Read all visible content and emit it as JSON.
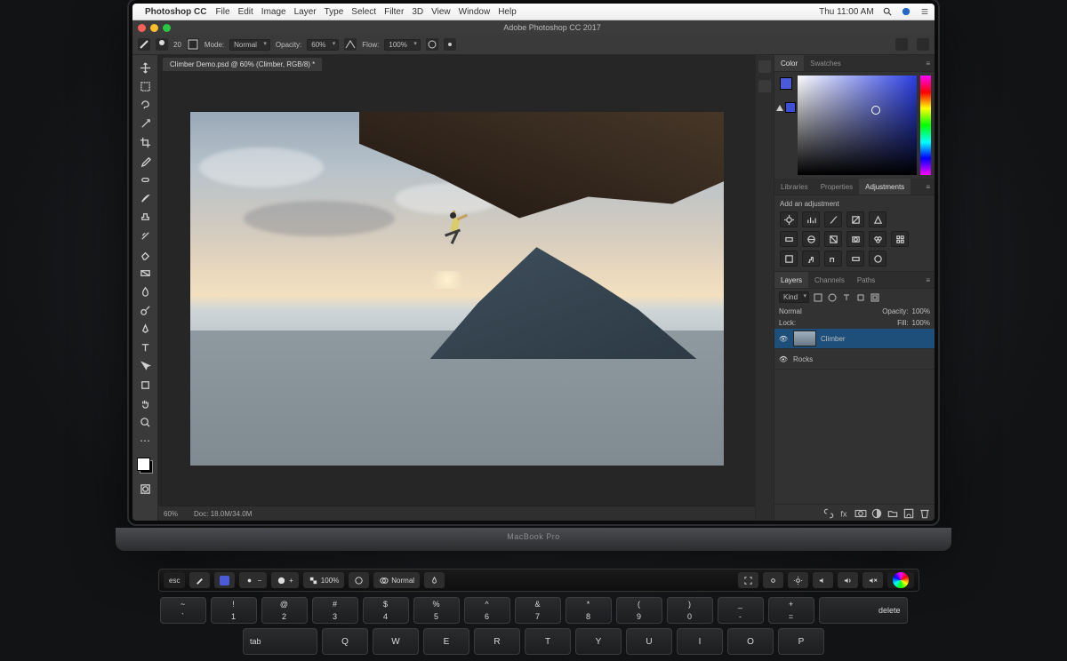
{
  "menubar": {
    "app": "Photoshop CC",
    "items": [
      "File",
      "Edit",
      "Image",
      "Layer",
      "Type",
      "Select",
      "Filter",
      "3D",
      "View",
      "Window",
      "Help"
    ],
    "clock": "Thu 11:00 AM"
  },
  "window": {
    "title": "Adobe Photoshop CC 2017"
  },
  "options": {
    "mode_label": "Mode:",
    "mode_value": "Normal",
    "opacity_label": "Opacity:",
    "opacity_value": "60%",
    "flow_label": "Flow:",
    "flow_value": "100%",
    "brush_size": "20"
  },
  "document": {
    "tab": "Climber Demo.psd @ 60% (Climber, RGB/8) *",
    "zoom": "60%",
    "doc_info": "Doc: 18.0M/34.0M"
  },
  "panels": {
    "color": {
      "tabs": [
        "Color",
        "Swatches"
      ]
    },
    "mid": {
      "tabs": [
        "Libraries",
        "Properties",
        "Adjustments"
      ],
      "heading": "Add an adjustment"
    },
    "layers": {
      "tabs": [
        "Layers",
        "Channels",
        "Paths"
      ],
      "kind": "Kind",
      "blend": "Normal",
      "opacity_label": "Opacity:",
      "opacity_value": "100%",
      "lock_label": "Lock:",
      "fill_label": "Fill:",
      "fill_value": "100%",
      "rows": [
        {
          "name": "Climber"
        },
        {
          "name": "Rocks"
        }
      ]
    }
  },
  "touchbar": {
    "esc": "esc",
    "size_value": "100%",
    "mode_value": "Normal"
  },
  "hinge": "MacBook Pro",
  "keys": {
    "row1": [
      "~\n`",
      "!\n1",
      "@\n2",
      "#\n3",
      "$\n4",
      "%\n5",
      "^\n6",
      "&\n7",
      "*\n8",
      "(\n9",
      ")\n0",
      "_\n-",
      "+\n="
    ],
    "delete": "delete",
    "tab": "tab",
    "row2": [
      "Q",
      "W",
      "E",
      "R",
      "T",
      "Y",
      "U",
      "I",
      "O",
      "P"
    ]
  }
}
